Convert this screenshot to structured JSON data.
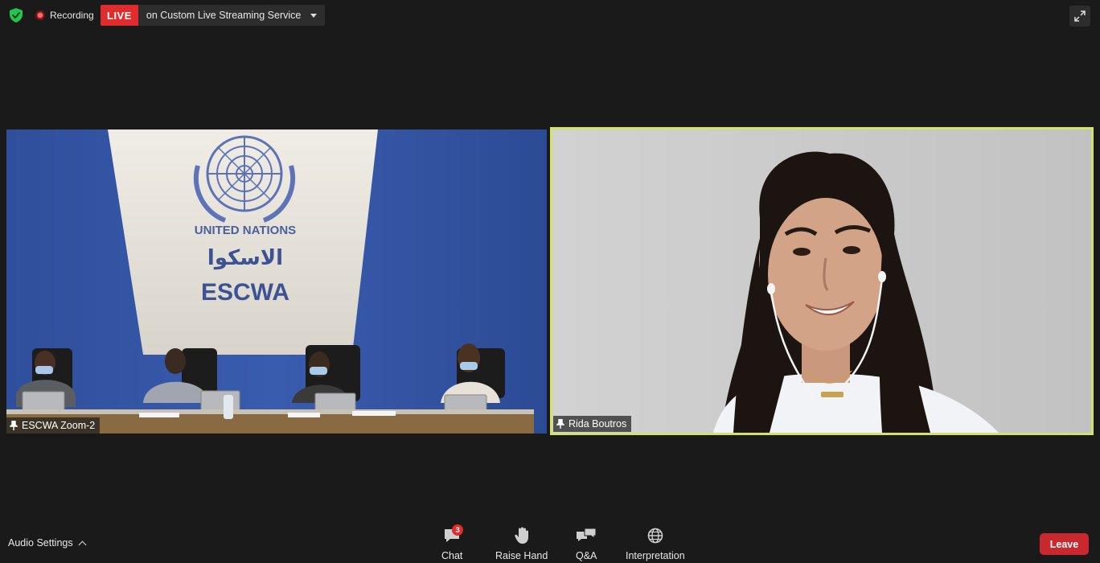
{
  "top_bar": {
    "recording_label": "Recording",
    "live_badge": "LIVE",
    "live_text": "on Custom Live Streaming Service"
  },
  "videos": [
    {
      "participant": "ESCWA Zoom-2",
      "wall": {
        "line1": "UNITED NATIONS",
        "arabic": "الاسكوا",
        "line2": "ESCWA"
      }
    },
    {
      "participant": "Rida Boutros"
    }
  ],
  "toolbar": {
    "audio_settings": "Audio Settings",
    "chat_label": "Chat",
    "chat_badge": "3",
    "raise_hand_label": "Raise Hand",
    "qa_label": "Q&A",
    "interpretation_label": "Interpretation",
    "leave_label": "Leave"
  },
  "colors": {
    "background": "#1a1a1a",
    "live_red": "#e02c2c",
    "active_speaker_border": "#d3e26a",
    "leave_red": "#c8282e"
  },
  "icons": {
    "security": "shield-check-icon",
    "recording": "record-dot-icon",
    "fullscreen": "expand-icon",
    "chat": "chat-bubble-icon",
    "raise_hand": "hand-icon",
    "qa": "qa-bubbles-icon",
    "interpretation": "globe-icon"
  }
}
